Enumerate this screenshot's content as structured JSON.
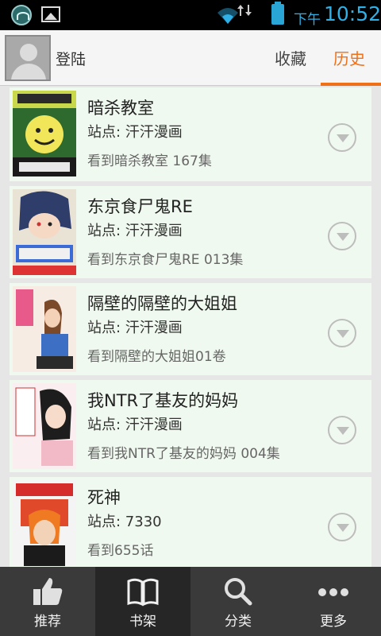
{
  "status_bar": {
    "ampm": "下午",
    "time": "10:52"
  },
  "header": {
    "login_label": "登陆",
    "tabs": [
      {
        "label": "收藏",
        "active": false
      },
      {
        "label": "历史",
        "active": true
      }
    ],
    "accent_color": "#f07018"
  },
  "history": [
    {
      "title": "暗杀教室",
      "site": "站点: 汗汗漫画",
      "progress": "看到暗杀教室 167集"
    },
    {
      "title": "东京食尸鬼RE",
      "site": "站点: 汗汗漫画",
      "progress": "看到东京食尸鬼RE 013集"
    },
    {
      "title": "隔壁的隔壁的大姐姐",
      "site": "站点: 汗汗漫画",
      "progress": "看到隔壁的大姐姐01卷"
    },
    {
      "title": "我NTR了基友的妈妈",
      "site": "站点: 汗汗漫画",
      "progress": "看到我NTR了基友的妈妈 004集"
    },
    {
      "title": "死神",
      "site": "站点: 7330",
      "progress": "看到655话"
    }
  ],
  "bottom_nav": [
    {
      "label": "推荐",
      "icon": "thumbs-up-icon",
      "active": false
    },
    {
      "label": "书架",
      "icon": "book-icon",
      "active": true
    },
    {
      "label": "分类",
      "icon": "search-icon",
      "active": false
    },
    {
      "label": "更多",
      "icon": "more-icon",
      "active": false
    }
  ]
}
